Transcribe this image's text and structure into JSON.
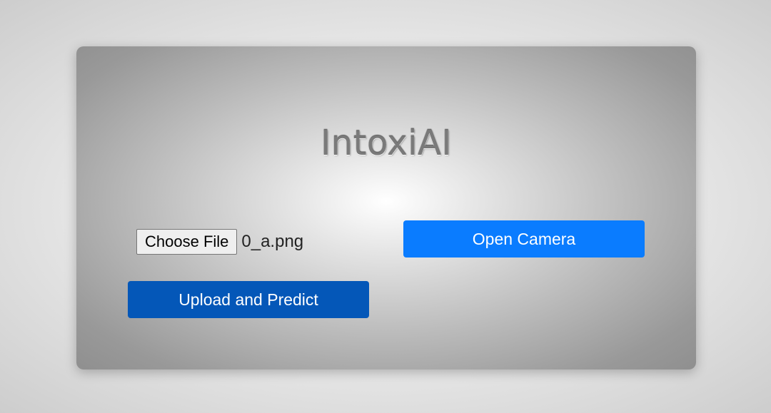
{
  "app": {
    "title": "IntoxiAI"
  },
  "upload": {
    "choose_file_label": "Choose File",
    "selected_file": "0_a.png",
    "submit_label": "Upload and Predict"
  },
  "camera": {
    "open_label": "Open Camera"
  },
  "colors": {
    "camera_button": "#0a7cff",
    "upload_button": "#0457b8"
  }
}
